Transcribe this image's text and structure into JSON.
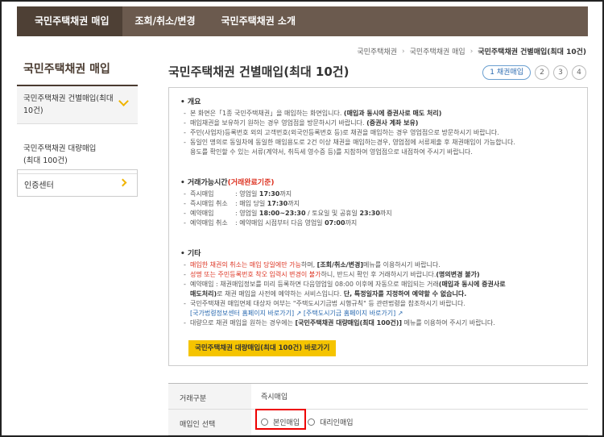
{
  "topnav": {
    "items": [
      "국민주택채권 매입",
      "조회/취소/변경",
      "국민주택채권 소개"
    ]
  },
  "breadcrumb": [
    "국민주택채권",
    "국민주택채권 매입",
    "국민주택채권 건별매입(최대 10건)"
  ],
  "sidebar": {
    "title": "국민주택채권 매입",
    "items": [
      "국민주택채권 건별매입(최대 10건)",
      "국민주택채권 대량매입\n(최대 100건)"
    ],
    "cert": "인증센터"
  },
  "page_title": "국민주택채권 건별매입(최대 10건)",
  "steps": [
    "1 채권매입",
    "2",
    "3",
    "4"
  ],
  "overview": {
    "title": "개요",
    "l1_a": "본 화면은「1종 국민주택채권」을 매입하는 화면입니다. ",
    "l1_b": "(매입과 동시에 증권사로 매도 처리)",
    "l2_a": "매입채권을 보유하기 원하는 경우 영업점을 방문하시기 바랍니다. ",
    "l2_b": "(증권사 계좌 보유)",
    "l3": "주민(사업자)등록번호 외의 고객번호(외국인등록번호 등)로 채권을 매입하는 경우 영업점으로 방문하시기 바랍니다.",
    "l4": "동일인 명의로 동일차에 동일한 매입용도로 2건 이상 채권을 매입하는경우, 영업점에 서류제출 후 채권매입이 가능합니다.",
    "l4b": "용도를 확인할 수 있는 서류(계약서, 취득세 영수증 등)를 지참하여 영업점으로 내점하여 주시기 바랍니다."
  },
  "hours": {
    "title": "거래가능시간",
    "title_red": "(거래완료기준)",
    "rows": [
      {
        "label": "즉시매입",
        "text_a": ": 영업일 ",
        "text_b": "17:30",
        "text_c": "까지"
      },
      {
        "label": "즉시매입 취소",
        "text_a": ": 매입 당일 ",
        "text_b": "17:30",
        "text_c": "까지"
      },
      {
        "label": "예약매입",
        "text_a": ": 영업일 ",
        "text_b": "18:00~23:30",
        "text_c": " / 토요일 및 공휴일 ",
        "text_d": "23:30",
        "text_e": "까지"
      },
      {
        "label": "예약매입 취소",
        "text_a": ": 예약매입 시점부터 다음 영업일 ",
        "text_b": "07:00",
        "text_c": "까지"
      }
    ]
  },
  "etc": {
    "title": "기타",
    "l1_red": "매입한 채권의 취소는 매입 당일에만 가능",
    "l1_a": "하며, ",
    "l1_b": "[조회/취소/변경]",
    "l1_c": "메뉴를 이용하시기 바랍니다.",
    "l2_red": "성명 또는 주민등록번호 착오 입력시 변경이 불가",
    "l2_a": "하니, 반드시 확인 후 거래하시기 바랍니다.",
    "l2_b": "(명의변경 불가)",
    "l3_a": "예약매입 : 채권매입정보를 미리 등록하면 다음영업일 08:00 이후에 자동으로 매입되는 거래",
    "l3_b": "(매입과 동시에 증권사로",
    "l3_c": "매도처리)",
    "l3_d": "로 채권 매입을 사전에 예약하는 서비스입니다. ",
    "l3_e": "단, 특정일자를 지정하여 예약할 수 없습니다.",
    "l4": "국민주택채권 매입면제 대상자 여부는 \"주택도시기금법 시행규칙\" 등 관련법령을 참조하시기 바랍니다.",
    "link1": "[국가법령정보센터 홈페이지 바로가기]",
    "link2": "[주택도시기금 홈페이지 바로가기]",
    "l5_a": "대량으로 채권 매입을 원하는 경우에는 ",
    "l5_b": "[국민주택채권 대량매입(최대 100건)]",
    "l5_c": " 메뉴를 이용하여 주시기 바랍니다.",
    "button": "국민주택채권 대량매입(최대 100건) 바로가기"
  },
  "form": {
    "row1_label": "거래구분",
    "row1_value": "즉시매입",
    "row2_label": "매입인 선택",
    "option1": "본인매입",
    "option2": "대리인매입"
  }
}
